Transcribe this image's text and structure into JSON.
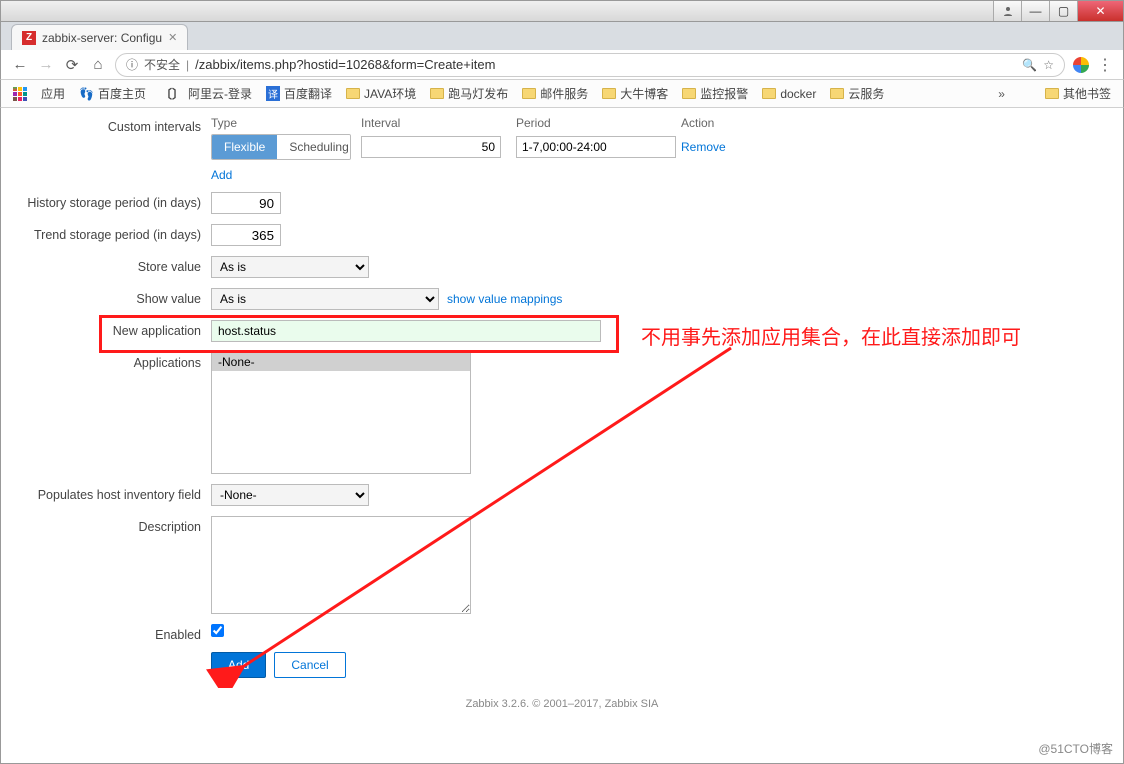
{
  "window": {
    "tab_title": "zabbix-server: Configu",
    "tab_favicon_letter": "Z"
  },
  "toolbar": {
    "insecure_label": "不安全",
    "url": "/zabbix/items.php?hostid=10268&form=Create+item"
  },
  "bookmarks": {
    "apps": "应用",
    "items": [
      "百度主页",
      "阿里云-登录",
      "百度翻译",
      "JAVA环境",
      "跑马灯发布",
      "邮件服务",
      "大牛博客",
      "监控报警",
      "docker",
      "云服务"
    ],
    "other": "其他书签"
  },
  "form": {
    "labels": {
      "custom_intervals": "Custom intervals",
      "type": "Type",
      "interval": "Interval",
      "period": "Period",
      "action": "Action",
      "flexible": "Flexible",
      "scheduling": "Scheduling",
      "remove": "Remove",
      "add": "Add",
      "history": "History storage period (in days)",
      "trend": "Trend storage period (in days)",
      "store_value": "Store value",
      "show_value": "Show value",
      "show_mappings": "show value mappings",
      "new_application": "New application",
      "applications": "Applications",
      "populates": "Populates host inventory field",
      "description": "Description",
      "enabled": "Enabled",
      "add_btn": "Add",
      "cancel_btn": "Cancel"
    },
    "values": {
      "interval": "50",
      "period": "1-7,00:00-24:00",
      "history_days": "90",
      "trend_days": "365",
      "store_value": "As is",
      "show_value": "As is",
      "new_application": "host.status",
      "applications_none": "-None-",
      "populates": "-None-",
      "description": "",
      "enabled": true
    }
  },
  "annotation": {
    "text": "不用事先添加应用集合，在此直接添加即可"
  },
  "footer": "Zabbix 3.2.6. © 2001–2017, Zabbix SIA",
  "watermark": "@51CTO博客"
}
